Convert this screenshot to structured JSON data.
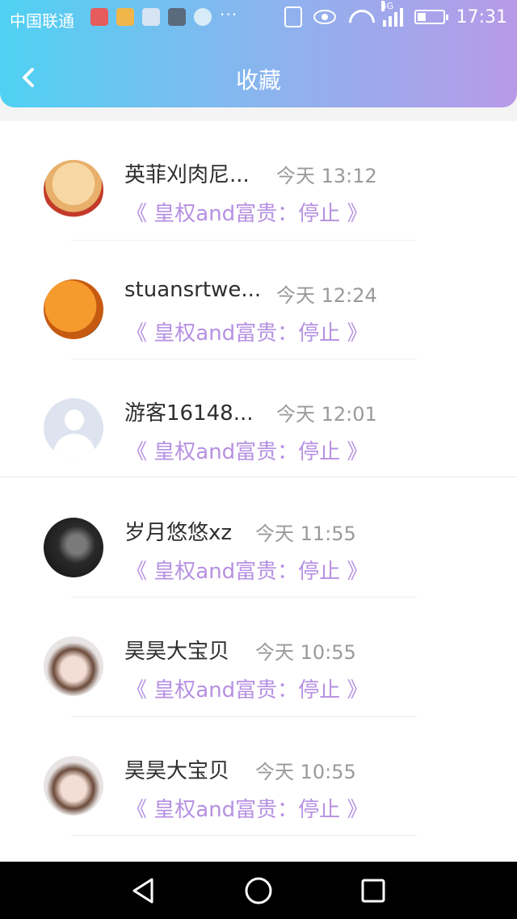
{
  "status_bar": {
    "carrier": "中国联通",
    "more": "···",
    "network": "4G",
    "time": "17:31"
  },
  "header": {
    "title": "收藏",
    "back_icon": "chevron-left-icon"
  },
  "items": [
    {
      "name": "英菲刈肉尼...",
      "time": "今天 13:12",
      "song": "《 皇权and富贵：停止 》",
      "avatar": "food-cartoon"
    },
    {
      "name": "stuansrtwe...",
      "time": "今天 12:24",
      "song": "《 皇权and富贵：停止 》",
      "avatar": "pumpkin"
    },
    {
      "name": "游客16148...",
      "time": "今天 12:01",
      "song": "《 皇权and富贵：停止 》",
      "avatar": "default-user"
    },
    {
      "name": "岁月悠悠xz",
      "time": "今天 11:55",
      "song": "《 皇权and富贵：停止 》",
      "avatar": "dark-portrait"
    },
    {
      "name": "昊昊大宝贝",
      "time": "今天 10:55",
      "song": "《 皇权and富贵：停止 》",
      "avatar": "boy-portrait"
    },
    {
      "name": "昊昊大宝贝",
      "time": "今天 10:55",
      "song": "《 皇权and富贵：停止 》",
      "avatar": "boy-portrait"
    }
  ],
  "colors": {
    "header_gradient": [
      "#4fd1f2",
      "#8eb2ee",
      "#b89ae8"
    ],
    "song_text": "#b690e2",
    "time_text": "#9a9a9a"
  },
  "nav_bar": {
    "back": "triangle-back-icon",
    "home": "circle-home-icon",
    "recents": "square-recents-icon"
  }
}
